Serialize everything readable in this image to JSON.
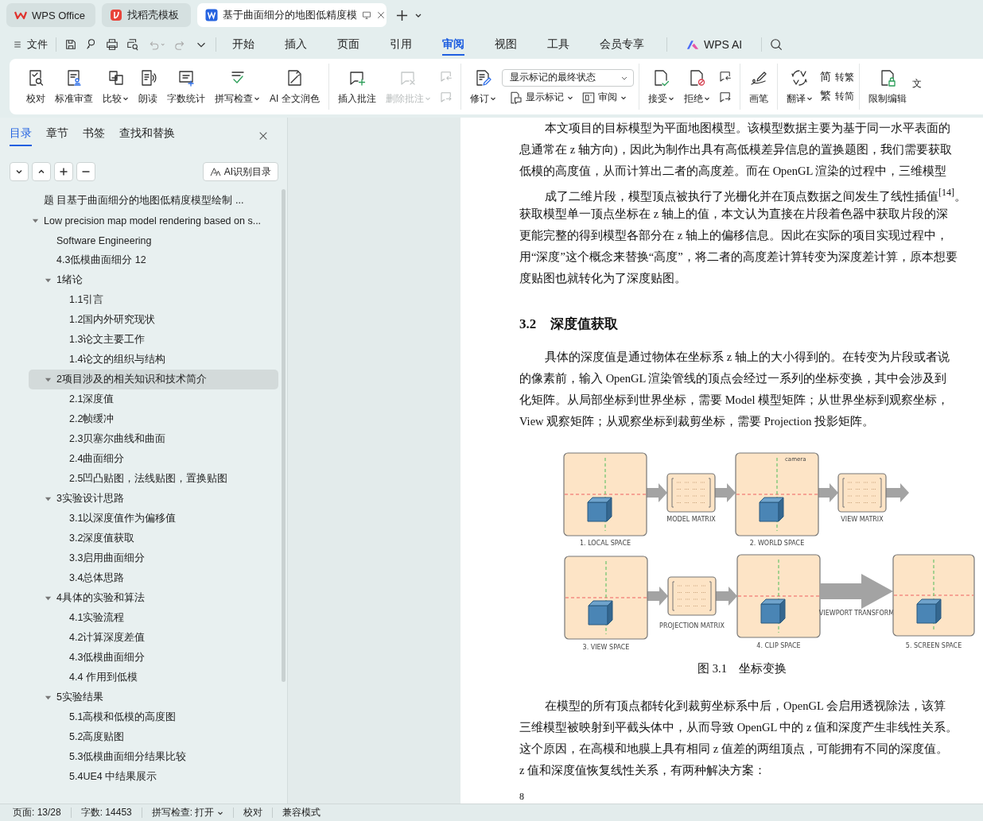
{
  "app_tabs": [
    {
      "kind": "home",
      "label": "WPS Office",
      "selected": false
    },
    {
      "kind": "template",
      "label": "找稻壳模板",
      "selected": false
    },
    {
      "kind": "document",
      "label": "基于曲面细分的地图低精度模",
      "selected": true
    }
  ],
  "menu": {
    "file": "文件",
    "tabs": [
      {
        "label": "开始",
        "selected": false
      },
      {
        "label": "插入",
        "selected": false
      },
      {
        "label": "页面",
        "selected": false
      },
      {
        "label": "引用",
        "selected": false
      },
      {
        "label": "审阅",
        "selected": true
      },
      {
        "label": "视图",
        "selected": false
      },
      {
        "label": "工具",
        "selected": false
      },
      {
        "label": "会员专享",
        "selected": false
      }
    ],
    "ai": "WPS AI"
  },
  "ribbon": {
    "groups": [
      {
        "columns": [
          [
            {
              "kind": "large",
              "label": "校对",
              "dropdown": false,
              "disabled": false
            }
          ],
          [
            {
              "kind": "large",
              "label": "标准审查",
              "dropdown": false,
              "disabled": false
            }
          ],
          [
            {
              "kind": "large",
              "label": "比较",
              "dropdown": true,
              "disabled": false
            }
          ],
          [
            {
              "kind": "large",
              "label": "朗读",
              "dropdown": false,
              "disabled": false
            }
          ],
          [
            {
              "kind": "large",
              "label": "字数统计",
              "dropdown": false,
              "disabled": false
            }
          ],
          [
            {
              "kind": "large",
              "label": "拼写检查",
              "dropdown": true,
              "disabled": false
            }
          ],
          [
            {
              "kind": "large",
              "label": "AI 全文润色",
              "dropdown": false,
              "disabled": false
            }
          ]
        ]
      },
      {
        "columns": [
          [
            {
              "kind": "large",
              "label": "插入批注",
              "dropdown": false,
              "disabled": false
            }
          ],
          [
            {
              "kind": "large",
              "label": "删除批注",
              "dropdown": true,
              "disabled": true
            }
          ],
          [
            {
              "kind": "small",
              "disabled": true
            },
            {
              "kind": "small",
              "disabled": true
            }
          ]
        ]
      },
      {
        "columns": [
          [
            {
              "kind": "large",
              "label": "修订",
              "dropdown": true,
              "disabled": false
            }
          ],
          [
            {
              "kind": "select",
              "value": "显示标记的最终状态"
            },
            {
              "kind": "compact",
              "label": "显示标记",
              "dropdown": true,
              "disabled": false
            },
            {
              "kind": "compact",
              "label": "审阅",
              "dropdown": true,
              "disabled": false
            }
          ]
        ]
      },
      {
        "columns": [
          [
            {
              "kind": "large",
              "label": "接受",
              "dropdown": true,
              "disabled": false
            }
          ],
          [
            {
              "kind": "large",
              "label": "拒绝",
              "dropdown": true,
              "disabled": false
            }
          ],
          [
            {
              "kind": "small",
              "disabled": false
            },
            {
              "kind": "small",
              "disabled": false
            }
          ]
        ]
      },
      {
        "columns": [
          [
            {
              "kind": "large",
              "label": "画笔",
              "dropdown": false,
              "disabled": false
            }
          ]
        ]
      },
      {
        "columns": [
          [
            {
              "kind": "large",
              "label": "翻译",
              "dropdown": true,
              "disabled": false
            }
          ],
          [
            {
              "kind": "char",
              "glyph": "简",
              "label": "转繁",
              "disabled": false
            },
            {
              "kind": "char",
              "glyph": "繁",
              "label": "转简",
              "disabled": false
            }
          ]
        ]
      },
      {
        "columns": [
          [
            {
              "kind": "large",
              "label": "限制编辑",
              "dropdown": false,
              "disabled": false
            }
          ],
          [
            {
              "kind": "label",
              "label": "文"
            }
          ]
        ]
      }
    ]
  },
  "sidebar": {
    "tabs": [
      {
        "label": "目录",
        "selected": true
      },
      {
        "label": "章节",
        "selected": false
      },
      {
        "label": "书签",
        "selected": false
      },
      {
        "label": "查找和替换",
        "selected": false
      }
    ],
    "ai_button": "AI识别目录",
    "outline": [
      {
        "label": "题 目基于曲面细分的地图低精度模型绘制 ...",
        "selected": false
      },
      {
        "label": "Low precision map model rendering based on s...",
        "selected": false,
        "expanded": true,
        "children": [
          {
            "label": "Software Engineering",
            "selected": false
          },
          {
            "label": "4.3低模曲面细分 12",
            "selected": false
          },
          {
            "label": "1绪论",
            "selected": false,
            "expanded": true,
            "children": [
              {
                "label": "1.1引言",
                "selected": false
              },
              {
                "label": "1.2国内外研究现状",
                "selected": false
              },
              {
                "label": "1.3论文主要工作",
                "selected": false
              },
              {
                "label": "1.4论文的组织与结构",
                "selected": false
              }
            ]
          },
          {
            "label": "2项目涉及的相关知识和技术简介",
            "selected": true,
            "expanded": true,
            "children": [
              {
                "label": "2.1深度值",
                "selected": false
              },
              {
                "label": "2.2帧缓冲",
                "selected": false
              },
              {
                "label": "2.3贝塞尔曲线和曲面",
                "selected": false
              },
              {
                "label": "2.4曲面细分",
                "selected": false
              },
              {
                "label": "2.5凹凸贴图，法线贴图，置换贴图",
                "selected": false
              }
            ]
          },
          {
            "label": "3实验设计思路",
            "selected": false,
            "expanded": true,
            "children": [
              {
                "label": "3.1以深度值作为偏移值",
                "selected": false
              },
              {
                "label": "3.2深度值获取",
                "selected": false
              },
              {
                "label": "3.3启用曲面细分",
                "selected": false
              },
              {
                "label": "3.4总体思路",
                "selected": false
              }
            ]
          },
          {
            "label": "4具体的实验和算法",
            "selected": false,
            "expanded": true,
            "children": [
              {
                "label": "4.1实验流程",
                "selected": false
              },
              {
                "label": "4.2计算深度差值",
                "selected": false
              },
              {
                "label": "4.3低模曲面细分",
                "selected": false
              },
              {
                "label": "4.4 作用到低模",
                "selected": false
              }
            ]
          },
          {
            "label": "5实验结果",
            "selected": false,
            "expanded": true,
            "children": [
              {
                "label": "5.1高模和低模的高度图",
                "selected": false
              },
              {
                "label": "5.2高度贴图",
                "selected": false
              },
              {
                "label": "5.3低模曲面细分结果比较",
                "selected": false
              },
              {
                "label": "5.4UE4 中结果展示",
                "selected": false
              }
            ]
          }
        ]
      }
    ]
  },
  "document": {
    "blocks": [
      {
        "kind": "paragraph",
        "lines": [
          {
            "text": "本文项目的目标模型为平面地图模型。该模型数据主要为基于同一水平表面的",
            "indent": true
          },
          {
            "text": "息通常在 z 轴方向)，因此为制作出具有高低模差异信息的置换题图，我们需要获取",
            "indent": false
          },
          {
            "text": "低模的高度值，从而计算出二者的高度差。而在 OpenGL 渲染的过程中，三维模型",
            "indent": false
          },
          {
            "text": "成了二维片段，模型顶点被执行了光栅化并在顶点数据之间发生了线性插值$^{[14]}$。",
            "indent": true
          },
          {
            "text": "获取模型单一顶点坐标在 z 轴上的值，本文认为直接在片段着色器中获取片段的深",
            "indent": false
          },
          {
            "text": "更能完整的得到模型各部分在 z 轴上的偏移信息。因此在实际的项目实现过程中，",
            "indent": false
          },
          {
            "text": "用“深度”这个概念来替换“高度”，将二者的高度差计算转变为深度差计算，原本想要",
            "indent": false
          },
          {
            "text": "度贴图也就转化为了深度贴图。",
            "indent": false
          }
        ]
      },
      {
        "kind": "heading",
        "number": "3.2",
        "title": "深度值获取"
      },
      {
        "kind": "paragraph",
        "lines": [
          {
            "text": "具体的深度值是通过物体在坐标系 z 轴上的大小得到的。在转变为片段或者说",
            "indent": true
          },
          {
            "text": "的像素前，输入 OpenGL 渲染管线的顶点会经过一系列的坐标变换，其中会涉及到",
            "indent": false
          },
          {
            "text": "化矩阵。从局部坐标到世界坐标，需要 Model 模型矩阵；从世界坐标到观察坐标，",
            "indent": false
          },
          {
            "text": "View 观察矩阵；从观察坐标到裁剪坐标，需要 Projection 投影矩阵。",
            "indent": false
          }
        ]
      },
      {
        "kind": "figure",
        "caption": "图 3.1　坐标变换",
        "panels": [
          {
            "kind": "space",
            "label": "1. LOCAL SPACE"
          },
          {
            "kind": "matrix",
            "label": "MODEL MATRIX"
          },
          {
            "kind": "space",
            "label": "2. WORLD SPACE",
            "note": "camera"
          },
          {
            "kind": "matrix",
            "label": "VIEW MATRIX"
          },
          {
            "kind": "space",
            "label": "3. VIEW SPACE"
          },
          {
            "kind": "matrix",
            "label": "PROJECTION MATRIX"
          },
          {
            "kind": "space",
            "label": "4. CLIP SPACE"
          },
          {
            "kind": "transform",
            "label": "VIEWPORT TRANSFORM"
          },
          {
            "kind": "space",
            "label": "5. SCREEN SPACE"
          }
        ]
      },
      {
        "kind": "paragraph",
        "lines": [
          {
            "text": "在模型的所有顶点都转化到裁剪坐标系中后，OpenGL 会启用透视除法，该算",
            "indent": true
          },
          {
            "text": "三维模型被映射到平截头体中，从而导致 OpenGL 中的 z 值和深度产生非线性关系。",
            "indent": false
          },
          {
            "text": "这个原因，在高模和地膜上具有相同 z 值差的两组顶点，可能拥有不同的深度值。",
            "indent": false
          },
          {
            "text": "z 值和深度值恢复线性关系，有两种解决方案：",
            "indent": false
          }
        ]
      }
    ],
    "page_number": "8"
  },
  "status_bar": [
    {
      "label": "页面: 13/28",
      "dropdown": false
    },
    {
      "label": "字数: 14453",
      "dropdown": false
    },
    {
      "label": "拼写检查: 打开",
      "dropdown": true
    },
    {
      "label": "校对",
      "dropdown": false
    },
    {
      "label": "兼容模式",
      "dropdown": false
    }
  ]
}
